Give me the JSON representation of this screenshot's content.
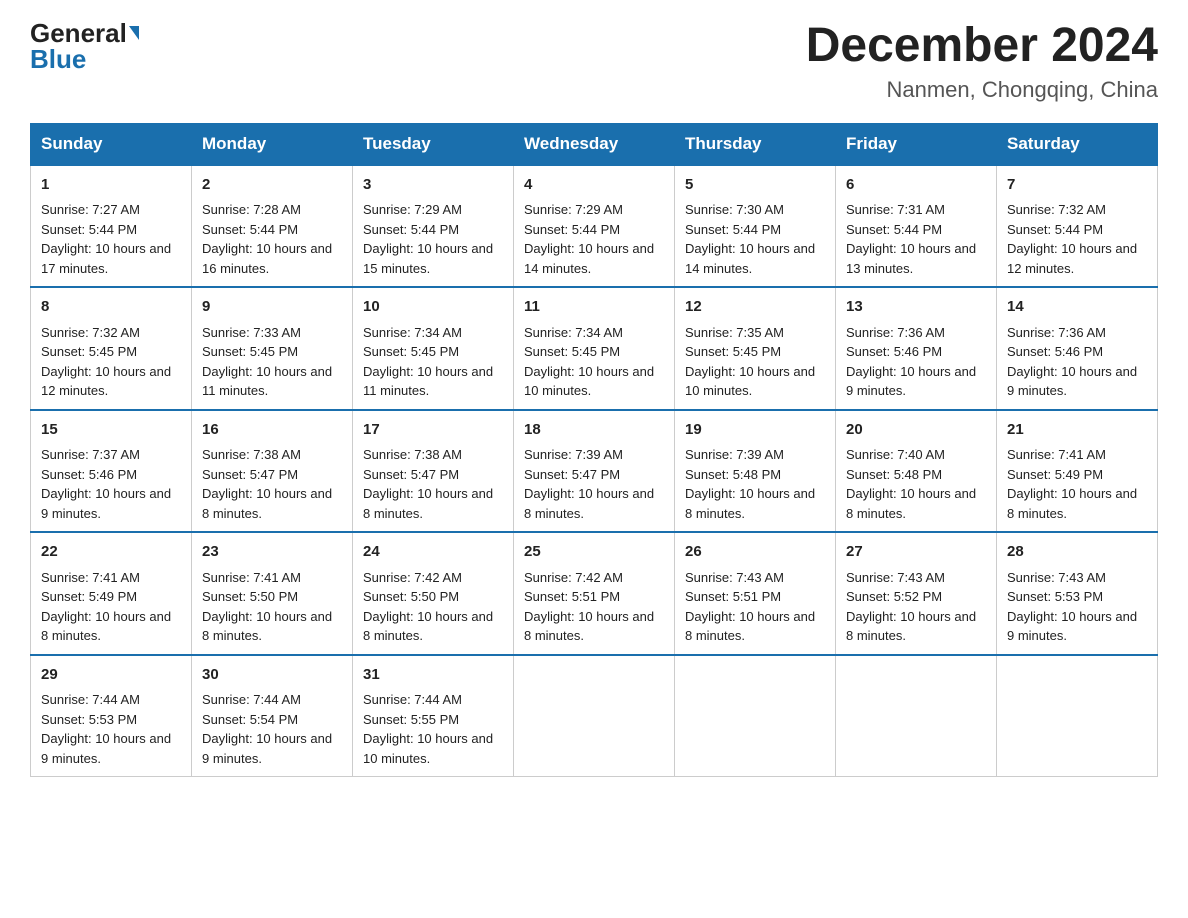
{
  "header": {
    "logo_general": "General",
    "logo_blue": "Blue",
    "month_year": "December 2024",
    "location": "Nanmen, Chongqing, China"
  },
  "days_of_week": [
    "Sunday",
    "Monday",
    "Tuesday",
    "Wednesday",
    "Thursday",
    "Friday",
    "Saturday"
  ],
  "weeks": [
    [
      {
        "day": "1",
        "sunrise": "7:27 AM",
        "sunset": "5:44 PM",
        "daylight": "10 hours and 17 minutes."
      },
      {
        "day": "2",
        "sunrise": "7:28 AM",
        "sunset": "5:44 PM",
        "daylight": "10 hours and 16 minutes."
      },
      {
        "day": "3",
        "sunrise": "7:29 AM",
        "sunset": "5:44 PM",
        "daylight": "10 hours and 15 minutes."
      },
      {
        "day": "4",
        "sunrise": "7:29 AM",
        "sunset": "5:44 PM",
        "daylight": "10 hours and 14 minutes."
      },
      {
        "day": "5",
        "sunrise": "7:30 AM",
        "sunset": "5:44 PM",
        "daylight": "10 hours and 14 minutes."
      },
      {
        "day": "6",
        "sunrise": "7:31 AM",
        "sunset": "5:44 PM",
        "daylight": "10 hours and 13 minutes."
      },
      {
        "day": "7",
        "sunrise": "7:32 AM",
        "sunset": "5:44 PM",
        "daylight": "10 hours and 12 minutes."
      }
    ],
    [
      {
        "day": "8",
        "sunrise": "7:32 AM",
        "sunset": "5:45 PM",
        "daylight": "10 hours and 12 minutes."
      },
      {
        "day": "9",
        "sunrise": "7:33 AM",
        "sunset": "5:45 PM",
        "daylight": "10 hours and 11 minutes."
      },
      {
        "day": "10",
        "sunrise": "7:34 AM",
        "sunset": "5:45 PM",
        "daylight": "10 hours and 11 minutes."
      },
      {
        "day": "11",
        "sunrise": "7:34 AM",
        "sunset": "5:45 PM",
        "daylight": "10 hours and 10 minutes."
      },
      {
        "day": "12",
        "sunrise": "7:35 AM",
        "sunset": "5:45 PM",
        "daylight": "10 hours and 10 minutes."
      },
      {
        "day": "13",
        "sunrise": "7:36 AM",
        "sunset": "5:46 PM",
        "daylight": "10 hours and 9 minutes."
      },
      {
        "day": "14",
        "sunrise": "7:36 AM",
        "sunset": "5:46 PM",
        "daylight": "10 hours and 9 minutes."
      }
    ],
    [
      {
        "day": "15",
        "sunrise": "7:37 AM",
        "sunset": "5:46 PM",
        "daylight": "10 hours and 9 minutes."
      },
      {
        "day": "16",
        "sunrise": "7:38 AM",
        "sunset": "5:47 PM",
        "daylight": "10 hours and 8 minutes."
      },
      {
        "day": "17",
        "sunrise": "7:38 AM",
        "sunset": "5:47 PM",
        "daylight": "10 hours and 8 minutes."
      },
      {
        "day": "18",
        "sunrise": "7:39 AM",
        "sunset": "5:47 PM",
        "daylight": "10 hours and 8 minutes."
      },
      {
        "day": "19",
        "sunrise": "7:39 AM",
        "sunset": "5:48 PM",
        "daylight": "10 hours and 8 minutes."
      },
      {
        "day": "20",
        "sunrise": "7:40 AM",
        "sunset": "5:48 PM",
        "daylight": "10 hours and 8 minutes."
      },
      {
        "day": "21",
        "sunrise": "7:41 AM",
        "sunset": "5:49 PM",
        "daylight": "10 hours and 8 minutes."
      }
    ],
    [
      {
        "day": "22",
        "sunrise": "7:41 AM",
        "sunset": "5:49 PM",
        "daylight": "10 hours and 8 minutes."
      },
      {
        "day": "23",
        "sunrise": "7:41 AM",
        "sunset": "5:50 PM",
        "daylight": "10 hours and 8 minutes."
      },
      {
        "day": "24",
        "sunrise": "7:42 AM",
        "sunset": "5:50 PM",
        "daylight": "10 hours and 8 minutes."
      },
      {
        "day": "25",
        "sunrise": "7:42 AM",
        "sunset": "5:51 PM",
        "daylight": "10 hours and 8 minutes."
      },
      {
        "day": "26",
        "sunrise": "7:43 AM",
        "sunset": "5:51 PM",
        "daylight": "10 hours and 8 minutes."
      },
      {
        "day": "27",
        "sunrise": "7:43 AM",
        "sunset": "5:52 PM",
        "daylight": "10 hours and 8 minutes."
      },
      {
        "day": "28",
        "sunrise": "7:43 AM",
        "sunset": "5:53 PM",
        "daylight": "10 hours and 9 minutes."
      }
    ],
    [
      {
        "day": "29",
        "sunrise": "7:44 AM",
        "sunset": "5:53 PM",
        "daylight": "10 hours and 9 minutes."
      },
      {
        "day": "30",
        "sunrise": "7:44 AM",
        "sunset": "5:54 PM",
        "daylight": "10 hours and 9 minutes."
      },
      {
        "day": "31",
        "sunrise": "7:44 AM",
        "sunset": "5:55 PM",
        "daylight": "10 hours and 10 minutes."
      },
      null,
      null,
      null,
      null
    ]
  ]
}
